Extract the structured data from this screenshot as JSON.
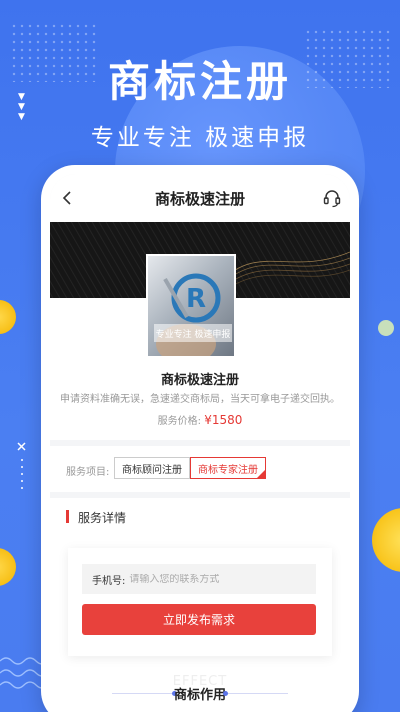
{
  "hero": {
    "title": "商标注册",
    "subtitle": "专业专注 极速申报"
  },
  "navbar": {
    "title": "商标极速注册",
    "back_icon": "chevron-left-icon",
    "service_icon": "headset-icon"
  },
  "product": {
    "image_tag": "专业专注 极速申报",
    "name": "商标极速注册",
    "description": "申请资料准确无误，急速递交商标局，当天可拿电子递交回执。",
    "price_label": "服务价格:",
    "price_value": "¥1580"
  },
  "service_items": {
    "label": "服务项目:",
    "options": [
      "商标顾问注册",
      "商标专家注册"
    ],
    "selected": "商标专家注册"
  },
  "detail": {
    "heading": "服务详情",
    "phone_label": "手机号:",
    "phone_placeholder": "请输入您的联系方式",
    "submit_label": "立即发布需求",
    "effect_en": "EFFECT",
    "effect_title": "商标作用"
  },
  "colors": {
    "background": "#4a7cf0",
    "accent": "#e53935",
    "button": "#e8413c"
  }
}
